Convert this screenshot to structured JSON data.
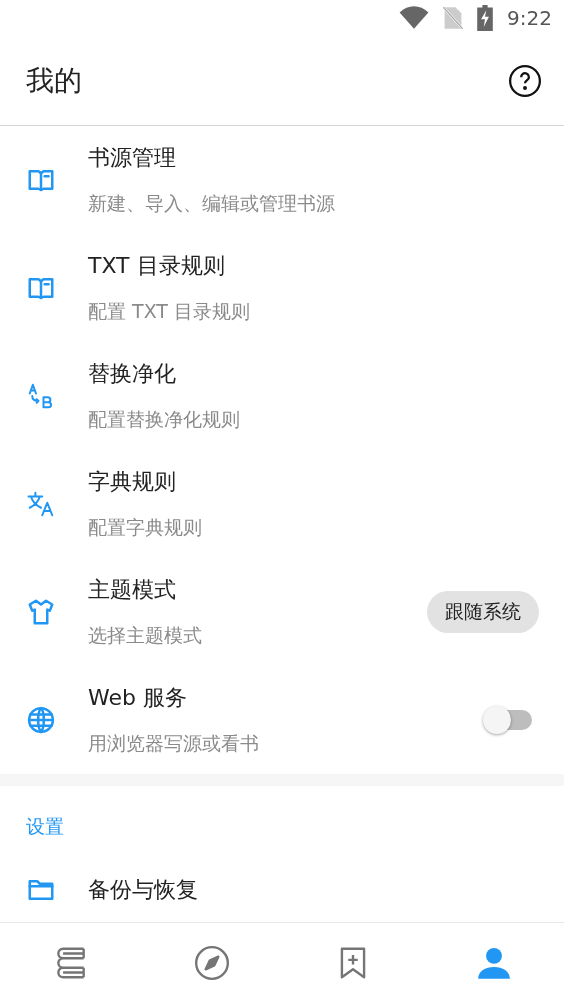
{
  "status_bar": {
    "time": "9:22"
  },
  "header": {
    "title": "我的"
  },
  "items": [
    {
      "kind": "plain",
      "title": "书源管理",
      "subtitle": "新建、导入、编辑或管理书源"
    },
    {
      "kind": "plain",
      "title": "TXT 目录规则",
      "subtitle": "配置 TXT 目录规则"
    },
    {
      "kind": "plain",
      "title": "替换净化",
      "subtitle": "配置替换净化规则"
    },
    {
      "kind": "plain",
      "title": "字典规则",
      "subtitle": "配置字典规则"
    },
    {
      "kind": "chip",
      "title": "主题模式",
      "subtitle": "选择主题模式",
      "value": "跟随系统"
    },
    {
      "kind": "switch",
      "title": "Web 服务",
      "subtitle": "用浏览器写源或看书",
      "on": false
    }
  ],
  "settings_section": {
    "title": "设置",
    "items": [
      {
        "title": "备份与恢复"
      }
    ]
  },
  "bottom_nav": [
    {
      "selected": false
    },
    {
      "selected": false
    },
    {
      "selected": false
    },
    {
      "selected": true
    }
  ]
}
